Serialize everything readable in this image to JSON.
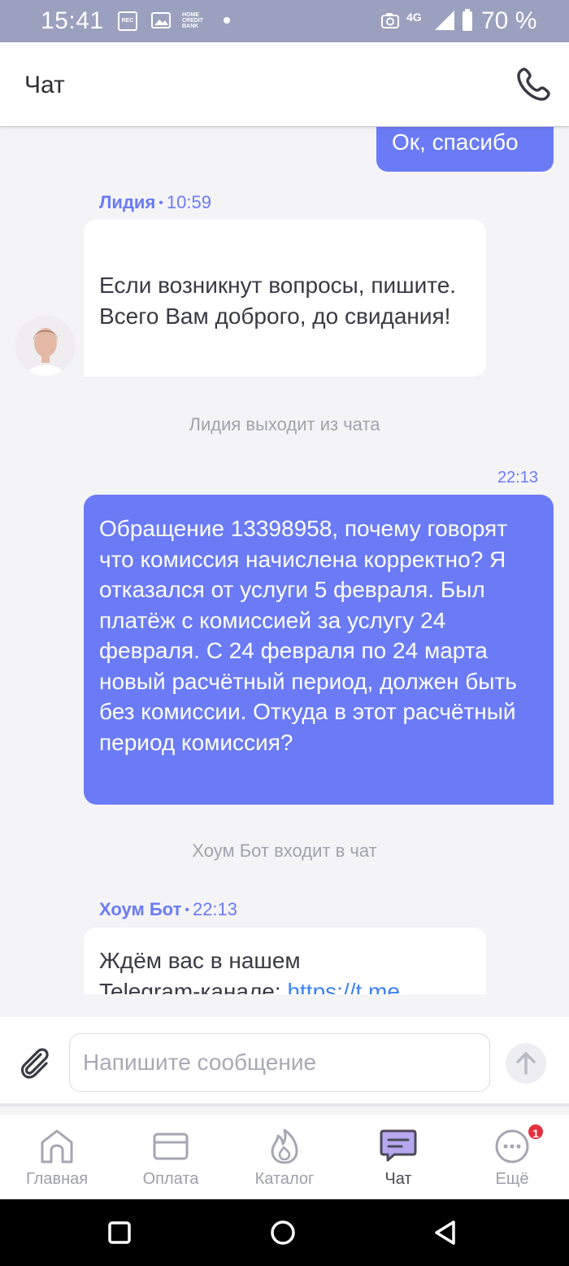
{
  "status_bar": {
    "time": "15:41",
    "rec_label": "REC",
    "bank_label": "HOME CREDIT BANK",
    "network": "4G",
    "battery": "70 %"
  },
  "header": {
    "title": "Чат"
  },
  "messages": {
    "out1": {
      "text": "Ок, спасибо"
    },
    "agent": {
      "name": "Лидия",
      "time": "10:59",
      "text": "Если возникнут вопросы, пишите. Всего Вам доброго, до свидания!"
    },
    "system1": "Лидия выходит из чата",
    "out2": {
      "time": "22:13",
      "text": "Обращение 13398958, почему говорят что комиссия начислена корректно? Я отказался от услуги 5 февраля. Был платёж с комиссией за услугу 24 февраля. С 24 февраля по 24 марта новый расчётный период, должен быть без комиссии. Откуда в этот расчётный период комиссия?"
    },
    "system2": "Хоум Бот входит в чат",
    "bot": {
      "name": "Хоум Бот",
      "time": "22:13",
      "text": "Ждём вас в нашем",
      "text2": "Telegram-канале: ",
      "link": "https://t.me"
    }
  },
  "input": {
    "placeholder": "Напишите сообщение"
  },
  "bottom_nav": {
    "items": [
      {
        "label": "Главная",
        "icon": "home-icon"
      },
      {
        "label": "Оплата",
        "icon": "card-icon"
      },
      {
        "label": "Каталог",
        "icon": "flame-icon"
      },
      {
        "label": "Чат",
        "icon": "chat-icon"
      },
      {
        "label": "Ещё",
        "icon": "more-icon",
        "badge": "1"
      }
    ]
  },
  "colors": {
    "accent": "#6b7bf5",
    "status_bar": "#9aa0bd",
    "badge": "#e5303e"
  }
}
